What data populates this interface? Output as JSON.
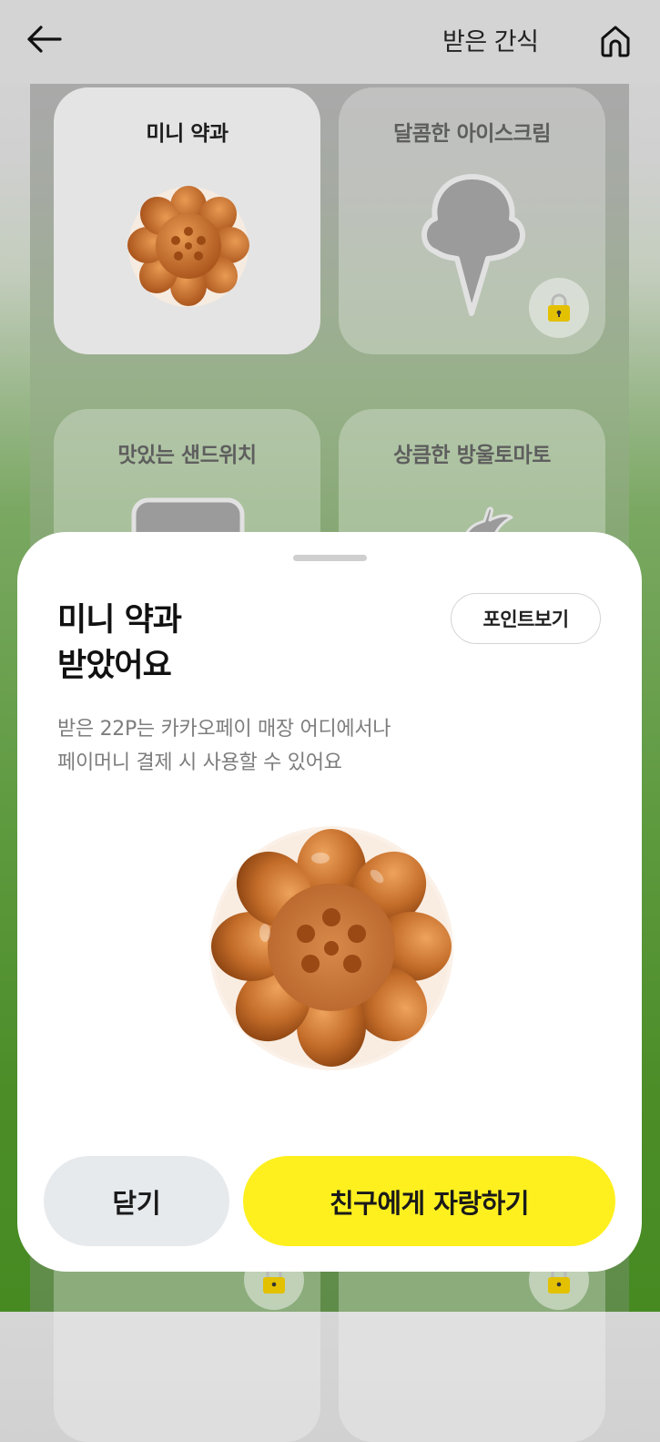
{
  "header": {
    "title": "받은 간식",
    "back_icon": "arrow-left-icon",
    "home_icon": "home-icon"
  },
  "grid": {
    "cards": [
      {
        "title": "미니 약과",
        "received": true,
        "icon": "yakgwa-icon"
      },
      {
        "title": "달콤한 아이스크림",
        "received": false,
        "icon": "ice-cream-icon"
      },
      {
        "title": "맛있는 샌드위치",
        "received": false,
        "icon": "sandwich-icon"
      },
      {
        "title": "상큼한 방울토마토",
        "received": false,
        "icon": "tomato-icon"
      }
    ]
  },
  "sheet": {
    "title_line1": "미니 약과",
    "title_line2": "받았어요",
    "points_button": "포인트보기",
    "desc_line1": "받은 22P는 카카오페이 매장 어디에서나",
    "desc_line2": "페이머니 결제 시 사용할 수 있어요",
    "close_button": "닫기",
    "share_button": "친구에게 자랑하기"
  },
  "colors": {
    "accent_yellow": "#fef01f",
    "close_gray": "#e7eaed",
    "lock_gold": "#e3c000",
    "yakgwa_brown": "#c46d2a"
  }
}
